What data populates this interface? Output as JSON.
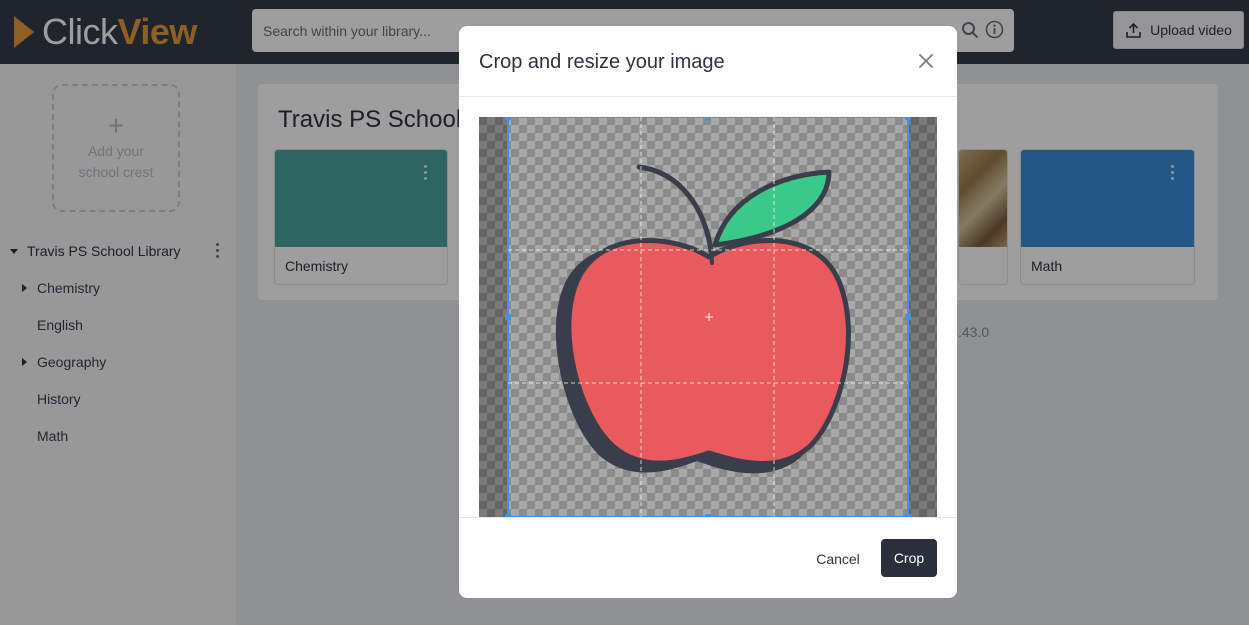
{
  "header": {
    "logo": {
      "text_part1": "Click",
      "text_part2": "View",
      "accent_color": "#e39a3a"
    },
    "search": {
      "placeholder": "Search within your library...",
      "value": ""
    },
    "upload_label": "Upload video"
  },
  "sidebar": {
    "crest": {
      "plus": "+",
      "line1": "Add your",
      "line2": "school crest"
    },
    "library_name": "Travis PS School Library",
    "items": [
      {
        "label": "Chemistry",
        "expandable": true
      },
      {
        "label": "English",
        "expandable": false
      },
      {
        "label": "Geography",
        "expandable": true
      },
      {
        "label": "History",
        "expandable": false
      },
      {
        "label": "Math",
        "expandable": true
      }
    ]
  },
  "main": {
    "title": "Travis PS School",
    "tiles": [
      {
        "label": "Chemistry",
        "color": "#4aa3a0"
      },
      {
        "label": "",
        "color": "image"
      },
      {
        "label": "Math",
        "color": "#3b8fd6"
      }
    ],
    "version_fragment": ".43.0"
  },
  "modal": {
    "title": "Crop and resize your image",
    "cancel_label": "Cancel",
    "crop_label": "Crop",
    "image": {
      "subject": "apple",
      "apple_color": "#e85a5b",
      "leaf_color": "#3ac98a",
      "outline_color": "#3a3d4a",
      "selection_color": "#4a90e2"
    }
  }
}
